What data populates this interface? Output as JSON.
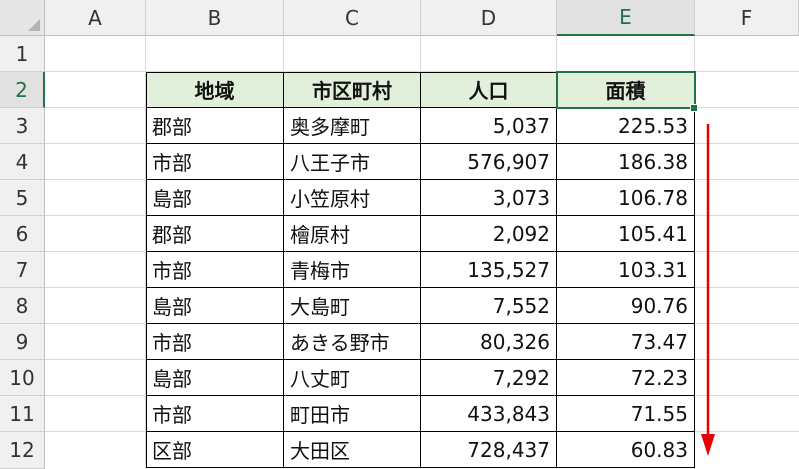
{
  "columns": [
    "A",
    "B",
    "C",
    "D",
    "E",
    "F"
  ],
  "selected_column": "E",
  "rows": [
    "1",
    "2",
    "3",
    "4",
    "5",
    "6",
    "7",
    "8",
    "9",
    "10",
    "11",
    "12"
  ],
  "table": {
    "headers": [
      "地域",
      "市区町村",
      "人口",
      "面積"
    ],
    "data": [
      [
        "郡部",
        "奥多摩町",
        "5,037",
        "225.53"
      ],
      [
        "市部",
        "八王子市",
        "576,907",
        "186.38"
      ],
      [
        "島部",
        "小笠原村",
        "3,073",
        "106.78"
      ],
      [
        "郡部",
        "檜原村",
        "2,092",
        "105.41"
      ],
      [
        "市部",
        "青梅市",
        "135,527",
        "103.31"
      ],
      [
        "島部",
        "大島町",
        "7,552",
        "90.76"
      ],
      [
        "市部",
        "あきる野市",
        "80,326",
        "73.47"
      ],
      [
        "島部",
        "八丈町",
        "7,292",
        "72.23"
      ],
      [
        "市部",
        "町田市",
        "433,843",
        "71.55"
      ],
      [
        "区部",
        "大田区",
        "728,437",
        "60.83"
      ]
    ]
  },
  "annotation": {
    "arrow_color": "#e60000",
    "direction": "down"
  },
  "colors": {
    "header_fill": "#e2efda",
    "selection": "#217346"
  }
}
